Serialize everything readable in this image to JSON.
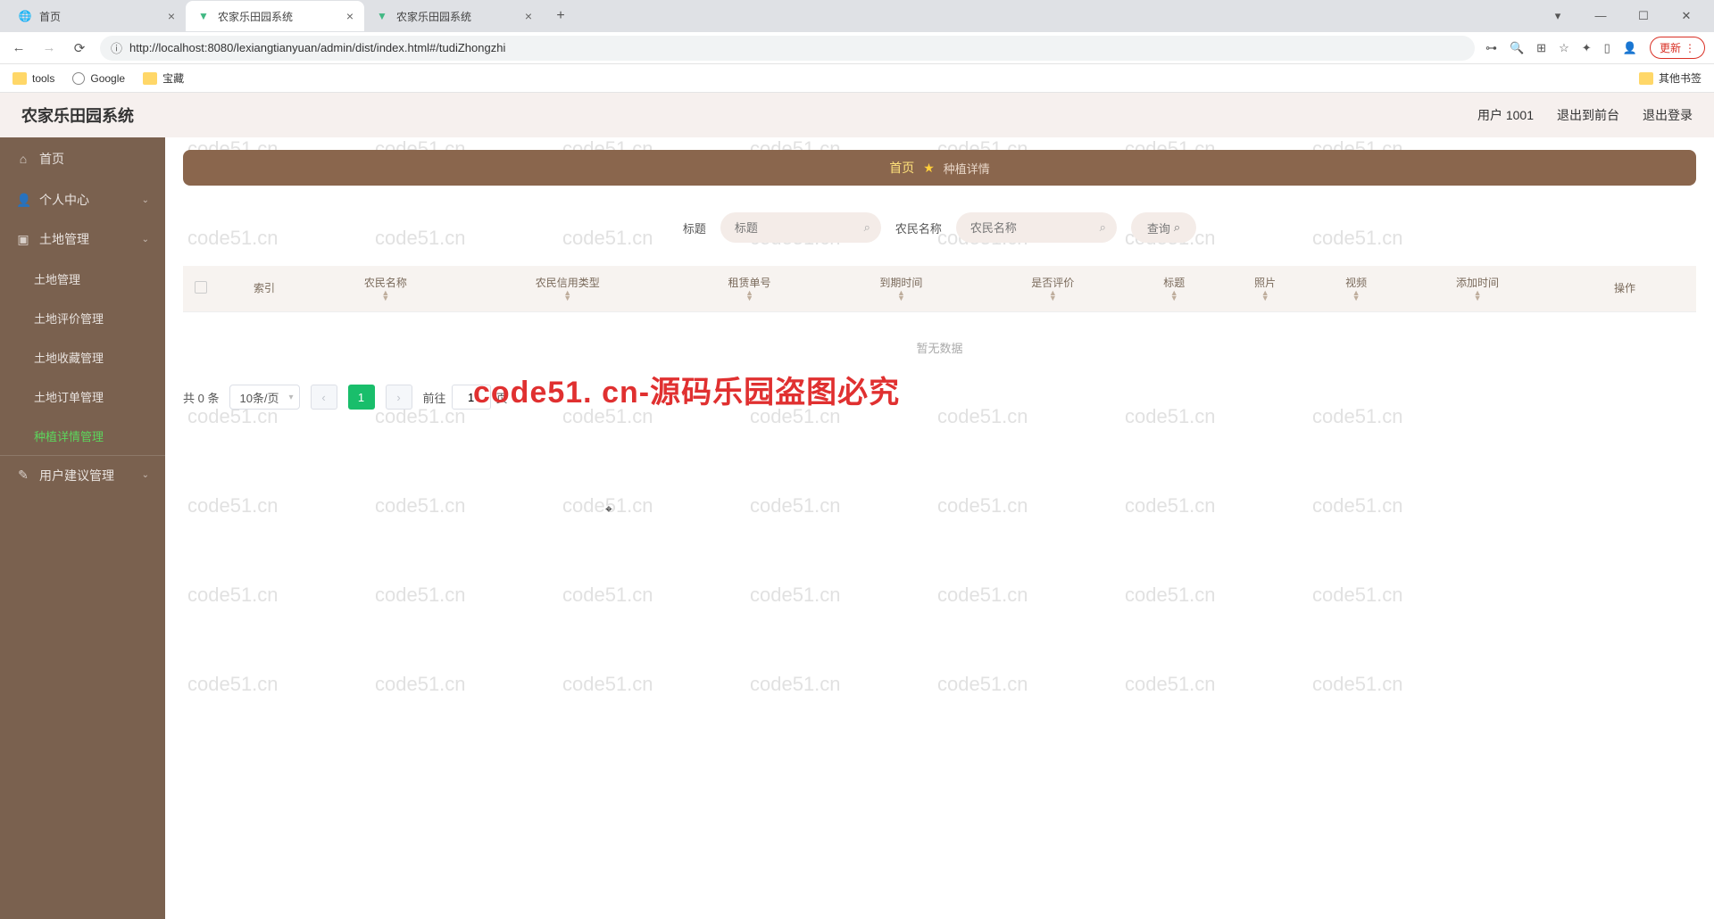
{
  "browser": {
    "tabs": [
      {
        "title": "首页",
        "icon": "globe"
      },
      {
        "title": "农家乐田园系统",
        "icon": "vue"
      },
      {
        "title": "农家乐田园系统",
        "icon": "vue"
      }
    ],
    "active_tab_index": 1,
    "url": "http://localhost:8080/lexiangtianyuan/admin/dist/index.html#/tudiZhongzhi",
    "update_label": "更新",
    "bookmarks": [
      {
        "label": "tools",
        "type": "folder"
      },
      {
        "label": "Google",
        "type": "globe"
      },
      {
        "label": "宝藏",
        "type": "folder"
      }
    ],
    "other_bookmarks": "其他书签"
  },
  "header": {
    "app_title": "农家乐田园系统",
    "user": "用户 1001",
    "to_front": "退出到前台",
    "logout": "退出登录"
  },
  "sidebar": {
    "home": "首页",
    "personal": "个人中心",
    "land_mgmt": "土地管理",
    "land_mgmt_items": [
      "土地管理",
      "土地评价管理",
      "土地收藏管理",
      "土地订单管理",
      "种植详情管理"
    ],
    "active_sub": "种植详情管理",
    "advice": "用户建议管理"
  },
  "crumb": {
    "home": "首页",
    "current": "种植详情"
  },
  "search": {
    "label_title": "标题",
    "ph_title": "标题",
    "label_farmer": "农民名称",
    "ph_farmer": "农民名称",
    "btn": "查询"
  },
  "table": {
    "columns": [
      "索引",
      "农民名称",
      "农民信用类型",
      "租赁单号",
      "到期时间",
      "是否评价",
      "标题",
      "照片",
      "视频",
      "添加时间",
      "操作"
    ],
    "empty": "暂无数据"
  },
  "pager": {
    "total_text": "共 0 条",
    "size_text": "10条/页",
    "current": "1",
    "goto_prefix": "前往",
    "goto_val": "1",
    "goto_suffix": "页"
  },
  "watermark": {
    "small": "code51.cn",
    "big": "code51. cn-源码乐园盗图必究"
  }
}
